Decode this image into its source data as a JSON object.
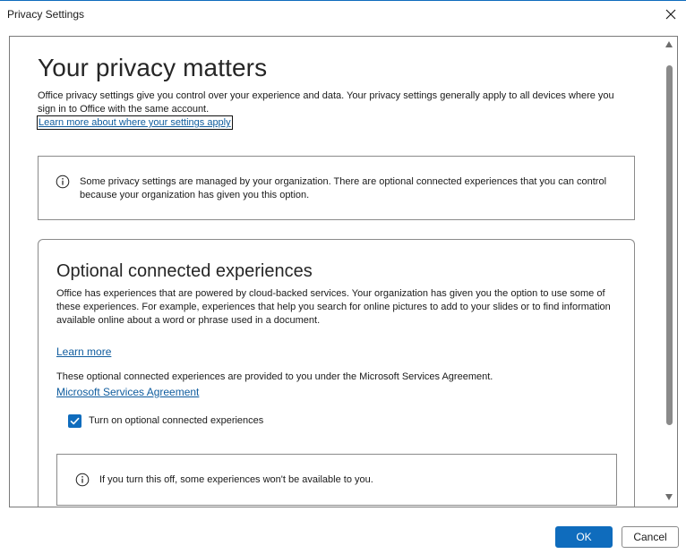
{
  "window": {
    "title": "Privacy Settings",
    "accent_color": "#0f6cbd"
  },
  "icons": {
    "close": "close-icon",
    "info": "info-icon",
    "check": "check-icon",
    "scroll_up": "scroll-up-arrow-icon",
    "scroll_down": "scroll-down-arrow-icon"
  },
  "header": {
    "heading": "Your privacy matters",
    "intro": "Office privacy settings give you control over your experience and data. Your privacy settings generally apply to all devices where you sign in to Office with the same account.",
    "intro_link": "Learn more about where your settings apply"
  },
  "managed_notice": {
    "text": "Some privacy settings are managed by your organization. There are optional connected experiences that you can control because your organization has given you this option."
  },
  "optional_section": {
    "heading": "Optional connected experiences",
    "description": "Office has experiences that are powered by cloud-backed services. Your organization has given you the option to use some of these experiences. For example, experiences that help you search for online pictures to add to your slides or to find information available online about a word or phrase used in a document.",
    "learn_more": "Learn more",
    "msa_text": "These optional connected experiences are provided to you under the Microsoft Services Agreement.",
    "msa_link": "Microsoft Services Agreement",
    "checkbox_label": "Turn on optional connected experiences",
    "checkbox_checked": true,
    "warning": "If you turn this off, some experiences won't be available to you."
  },
  "footer": {
    "ok_label": "OK",
    "cancel_label": "Cancel"
  }
}
